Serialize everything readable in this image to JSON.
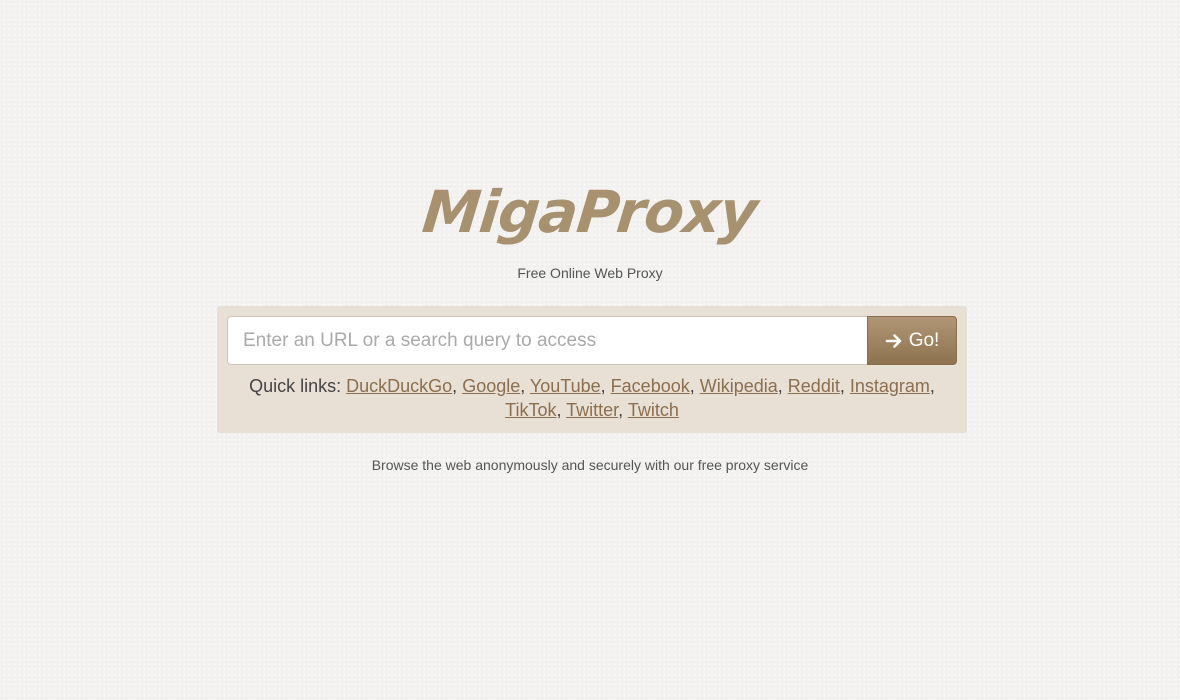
{
  "brand": {
    "logo_text": "MigaProxy",
    "tagline": "Free Online Web Proxy"
  },
  "search": {
    "placeholder": "Enter an URL or a search query to access",
    "value": "",
    "go_label": "Go!",
    "go_icon": "arrow-right-icon"
  },
  "quick_links": {
    "label": "Quick links:",
    "separator": ", ",
    "links": [
      {
        "label": "DuckDuckGo"
      },
      {
        "label": "Google"
      },
      {
        "label": "YouTube"
      },
      {
        "label": "Facebook"
      },
      {
        "label": "Wikipedia"
      },
      {
        "label": "Reddit"
      },
      {
        "label": "Instagram"
      },
      {
        "label": "TikTok"
      },
      {
        "label": "Twitter"
      },
      {
        "label": "Twitch"
      }
    ]
  },
  "footer": {
    "text": "Browse the web anonymously and securely with our free proxy service"
  },
  "colors": {
    "brand": "#a8916f",
    "panel": "#e8dfd5",
    "link": "#8b6f4e",
    "button": "#9c825f"
  }
}
